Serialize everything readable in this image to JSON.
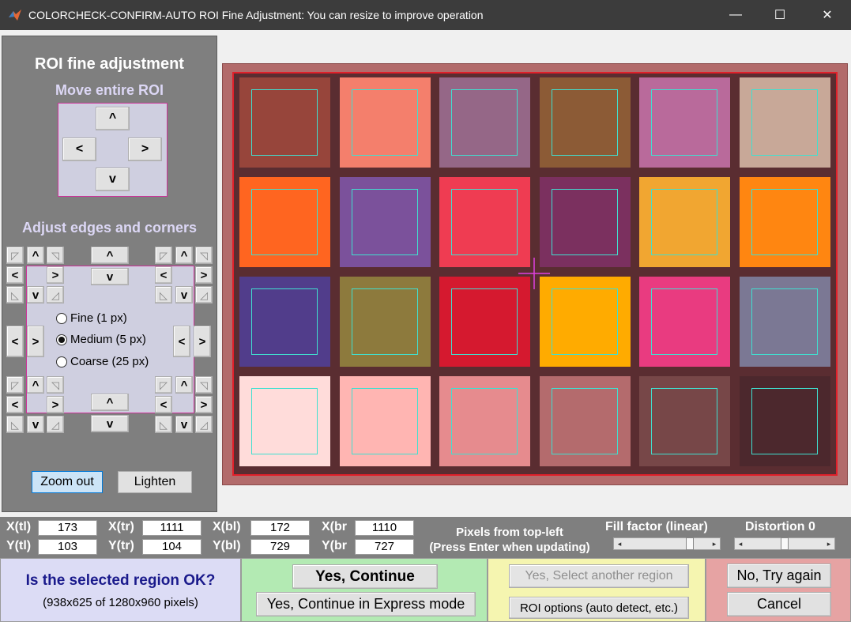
{
  "window": {
    "title": "COLORCHECK-CONFIRM-AUTO ROI Fine Adjustment: You can resize to improve operation",
    "minimize": "—",
    "maximize": "☐",
    "close": "✕"
  },
  "left_panel": {
    "title": "ROI fine adjustment",
    "move_heading": "Move entire ROI",
    "edges_heading": "Adjust edges and corners",
    "arrows": {
      "up": "^",
      "down": "v",
      "left": "<",
      "right": ">"
    },
    "corners": {
      "tl": "◸",
      "tr": "◹",
      "bl": "◺",
      "br": "◿"
    },
    "step_options": [
      {
        "label": "Fine (1 px)",
        "selected": false
      },
      {
        "label": "Medium (5 px)",
        "selected": true
      },
      {
        "label": "Coarse (25 px)",
        "selected": false
      }
    ],
    "zoom_out": "Zoom out",
    "lighten": "Lighten"
  },
  "chart": {
    "patch_colors": [
      [
        "#97453b",
        "#f47f6c",
        "#956787",
        "#8c5b36",
        "#b96a9b",
        "#c8a898"
      ],
      [
        "#ff6520",
        "#7b519b",
        "#ef3c52",
        "#7b305f",
        "#f1a631",
        "#ff8611"
      ],
      [
        "#513d8b",
        "#8d7a3d",
        "#d5192f",
        "#ffab00",
        "#e93b80",
        "#7b7894"
      ],
      [
        "#ffdcda",
        "#ffb5b2",
        "#e68b8e",
        "#b46b6d",
        "#774748",
        "#4c282d"
      ]
    ],
    "roi_color": "#40e0d0",
    "border_color": "#e0202a"
  },
  "coords": {
    "xtl_label": "X(tl)",
    "xtl": "173",
    "ytl_label": "Y(tl)",
    "ytl": "103",
    "xtr_label": "X(tr)",
    "xtr": "1111",
    "ytr_label": "Y(tr)",
    "ytr": "104",
    "xbl_label": "X(bl)",
    "xbl": "172",
    "ybl_label": "Y(bl)",
    "ybl": "729",
    "xbr_label": "X(br",
    "xbr": "1110",
    "ybr_label": "Y(br",
    "ybr": "727",
    "note_line1": "Pixels from top-left",
    "note_line2": "(Press Enter when updating)",
    "fill_label": "Fill factor (linear)",
    "fill_value": 0.8,
    "distortion_label": "Distortion 0",
    "distortion_value": 0.5
  },
  "bottom": {
    "question": "Is the selected region OK?",
    "size_info": "(938x625 of 1280x960 pixels)",
    "yes_continue": "Yes, Continue",
    "yes_express": "Yes, Continue in Express mode",
    "select_another": "Yes, Select another region",
    "roi_options": "ROI options (auto detect, etc.)",
    "no_try": "No, Try again",
    "cancel": "Cancel"
  }
}
